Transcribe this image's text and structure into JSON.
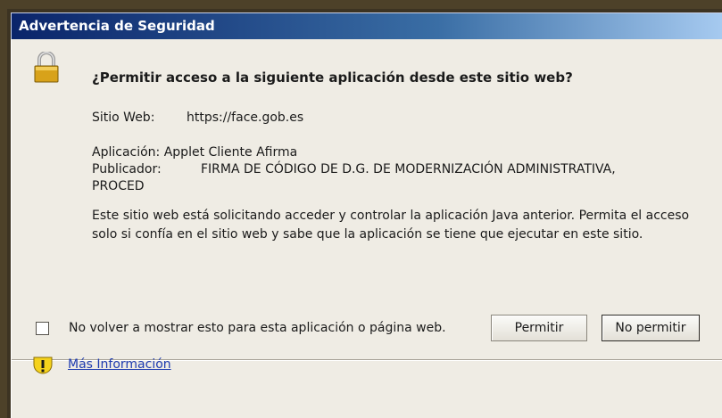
{
  "window": {
    "title": "Advertencia de Seguridad"
  },
  "dialog": {
    "question": "¿Permitir acceso a la siguiente aplicación desde este sitio web?",
    "website_label": "Sitio Web:",
    "website_value": "https://face.gob.es",
    "app_line": "Aplicación: Applet Cliente Afirma",
    "publisher_label": "Publicador:",
    "publisher_value": "FIRMA DE CÓDIGO DE D.G. DE MODERNIZACIÓN ADMINISTRATIVA,",
    "publisher_value_cont": "PROCED",
    "description": "Este sitio web está solicitando acceder y controlar la aplicación Java anterior. Permita el acceso solo si confía en el sitio web y sabe que la aplicación se tiene que ejecutar en este sitio.",
    "checkbox_label": "No volver a mostrar esto para esta aplicación o página web.",
    "checkbox_checked": false,
    "allow_button": "Permitir",
    "deny_button": "No permitir",
    "more_info_link": "Más Información"
  },
  "icons": {
    "header_icon": "lock-icon",
    "footer_icon": "warning-icon"
  },
  "colors": {
    "title_bar_start": "#0a246a",
    "title_bar_end": "#a6caf0",
    "dialog_background": "#efece4",
    "link": "#1e3bb0",
    "lock_body": "#d8a21a",
    "warning_fill": "#f5d21c"
  }
}
